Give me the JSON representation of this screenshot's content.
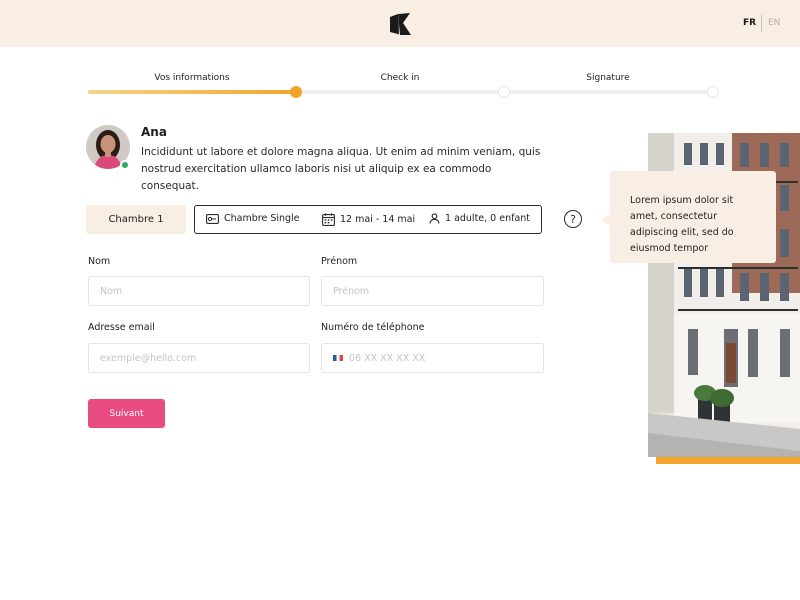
{
  "header": {
    "languages": {
      "fr": "FR",
      "en": "EN"
    }
  },
  "steps": {
    "items": [
      {
        "label": "Vos informations"
      },
      {
        "label": "Check in"
      },
      {
        "label": "Signature"
      }
    ],
    "current_index": 0,
    "progress_fraction": 0.333
  },
  "profile": {
    "name": "Ana",
    "intro": "Incididunt ut labore et dolore magna aliqua. Ut enim ad minim veniam, quis nostrud exercitation ullamco laboris nisi ut aliquip ex ea commodo consequat.",
    "status": "online"
  },
  "room": {
    "tab_label": "Chambre 1",
    "type": "Chambre Single",
    "dates": "12 mai - 14 mai",
    "guests": "1 adulte, 0 enfant",
    "help_symbol": "?"
  },
  "form": {
    "last_name": {
      "label": "Nom",
      "placeholder": "Nom",
      "value": ""
    },
    "first_name": {
      "label": "Prénom",
      "placeholder": "Prénom",
      "value": ""
    },
    "email": {
      "label": "Adresse email",
      "placeholder": "exemple@hello.com",
      "value": ""
    },
    "phone": {
      "label": "Numéro de téléphone",
      "placeholder": "06 XX XX XX XX",
      "value": ""
    },
    "submit_label": "Suivant"
  },
  "tooltip": {
    "text": "Lorem ipsum dolor sit amet, consectetur adipiscing elit, sed do eiusmod tempor"
  },
  "colors": {
    "header_bg": "#f8eee4",
    "accent_orange": "#f3a52b",
    "button_pink": "#e84c83",
    "online_green": "#27ae60"
  },
  "icons": {
    "logo": "k-logo-icon",
    "room": "key-card-icon",
    "dates": "calendar-icon",
    "guests": "person-icon",
    "help": "question-circle-icon",
    "phone_flag": "french-flag-icon"
  }
}
